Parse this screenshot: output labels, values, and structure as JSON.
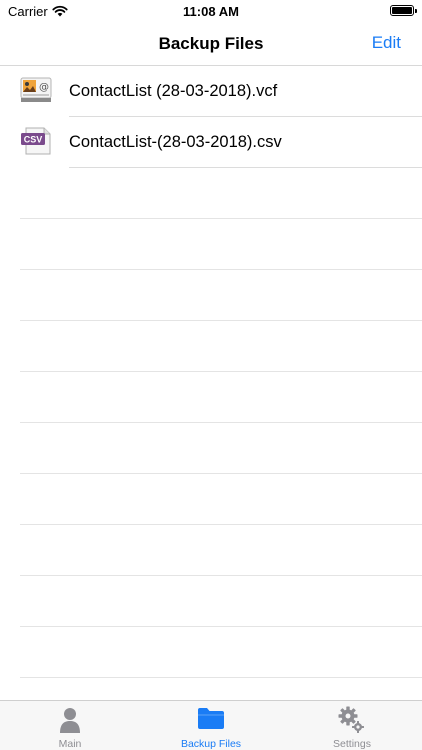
{
  "status_bar": {
    "carrier": "Carrier",
    "time": "11:08 AM",
    "wifi_icon": "wifi-icon",
    "battery_icon": "battery-icon"
  },
  "nav": {
    "title": "Backup Files",
    "edit_label": "Edit"
  },
  "files": [
    {
      "name": "ContactList (28-03-2018).vcf",
      "icon": "vcard-file-icon"
    },
    {
      "name": "ContactList-(28-03-2018).csv",
      "icon": "csv-file-icon",
      "icon_text": "CSV"
    }
  ],
  "tabs": [
    {
      "label": "Main",
      "icon": "person-icon",
      "active": false
    },
    {
      "label": "Backup Files",
      "icon": "folder-icon",
      "active": true
    },
    {
      "label": "Settings",
      "icon": "gears-icon",
      "active": false
    }
  ],
  "colors": {
    "accent": "#1a7cf5",
    "inactive": "#8e8e93",
    "csv_badge": "#7a4a8c"
  }
}
